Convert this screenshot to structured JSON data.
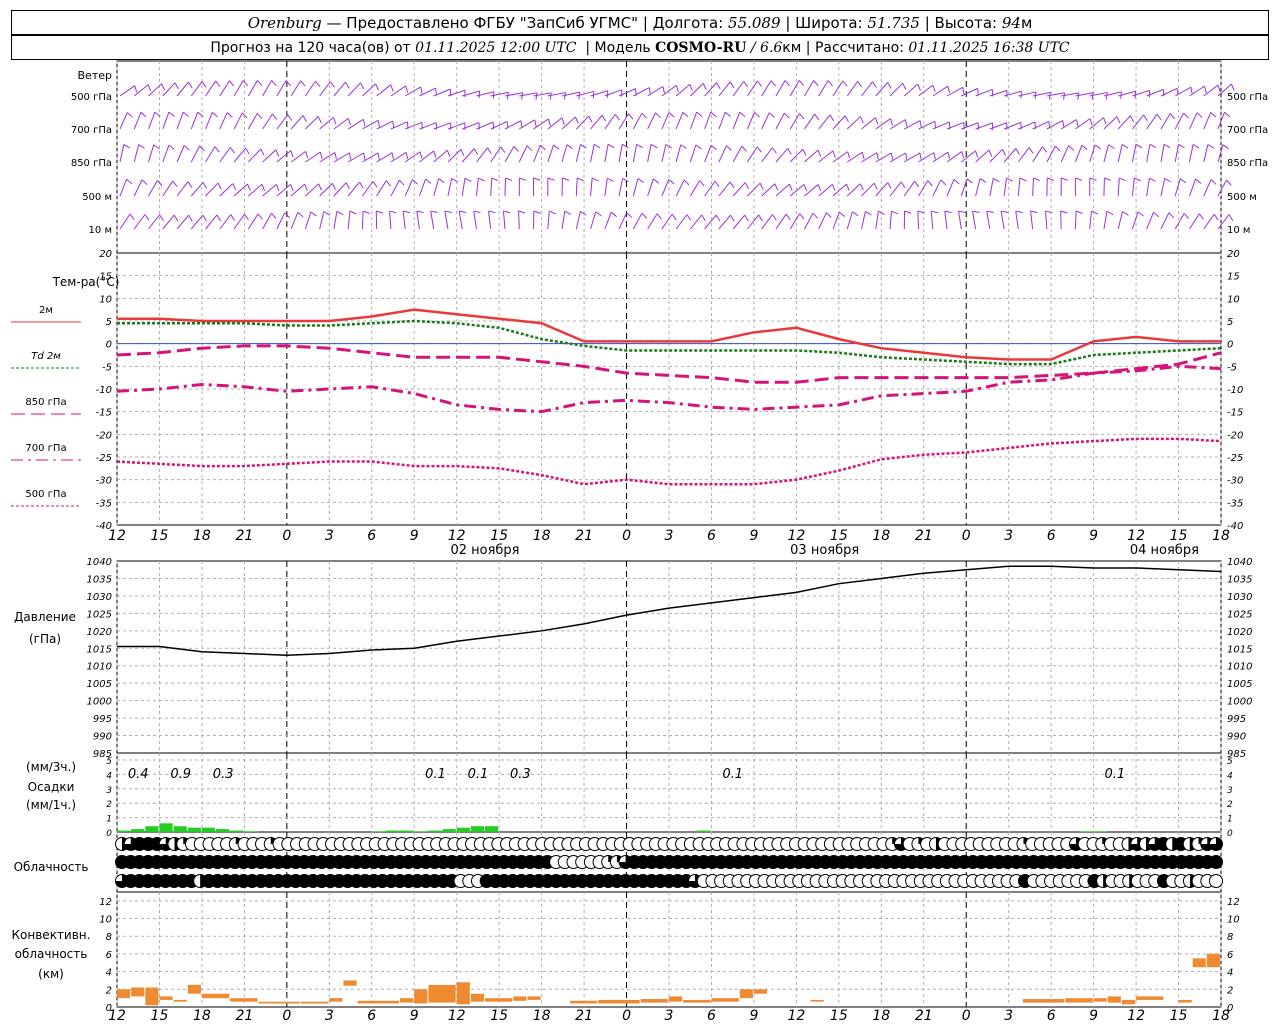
{
  "header": {
    "city": "Orenburg",
    "dash": "—",
    "provider": "Предоставлено ФГБУ \"ЗапСиб УГМС\"",
    "lon_label": "Долгота:",
    "lon": "55.089",
    "lat_label": "Широта:",
    "lat": "51.735",
    "alt_label": "Высота:",
    "alt": "94",
    "alt_unit": "м",
    "sep": "|"
  },
  "subheader": {
    "forecast_label": "Прогноз на 120 часа(ов) от",
    "forecast_time": "01.11.2025 12:00 UTC",
    "model_label": "Модель",
    "model": "COSMO-RU",
    "model_res_sep": "/",
    "model_res": "6.6",
    "model_res_unit": "км",
    "calc_label": "Рассчитано:",
    "calc_time": "01.11.2025 16:38 UTC",
    "sep": "|"
  },
  "colors": {
    "wind": "#9b30d9",
    "t2m": "#e83a3a",
    "td2m": "#1a7a1a",
    "t850": "#d4147a",
    "t700": "#d4147a",
    "t500": "#d4147a",
    "zero_line": "#3050d0",
    "pressure": "#000000",
    "precip": "#22cc22",
    "convective": "#f08a30",
    "grid": "#b0b0b0"
  },
  "labels": {
    "wind_title": "Ветер",
    "wind_levels": [
      "500 гПа",
      "700 гПа",
      "850 гПа",
      "500 м",
      "10  м"
    ],
    "temp_title": "Тем-ра(°С)",
    "temp_legend": [
      "2м",
      "Td  2м",
      "850 гПа",
      "700 гПа",
      "500 гПа"
    ],
    "pressure_title": "Давление",
    "pressure_unit": "(гПа)",
    "precip_labels": [
      "(мм/3ч.)",
      "Осадки",
      "(мм/1ч.)"
    ],
    "cloud_title": "Облачность",
    "conv_labels": [
      "Конвективн.",
      "облачность",
      "(км)"
    ]
  },
  "time_axis": {
    "ticks": [
      "12",
      "15",
      "18",
      "21",
      "0",
      "3",
      "6",
      "9",
      "12",
      "15",
      "18",
      "21",
      "0",
      "3",
      "6",
      "9",
      "12",
      "15",
      "18",
      "21",
      "0",
      "3",
      "6",
      "9",
      "12",
      "15",
      "18"
    ],
    "dates": [
      "02 ноября",
      "03 ноября",
      "04 ноября"
    ]
  },
  "chart_data": [
    {
      "type": "line",
      "title": "Тем-ра(°С)",
      "ylim": [
        -40,
        20
      ],
      "yticks": [
        20,
        15,
        10,
        5,
        0,
        -5,
        -10,
        -15,
        -20,
        -25,
        -30,
        -35,
        -40
      ],
      "x_hours": [
        0,
        3,
        6,
        9,
        12,
        15,
        18,
        21,
        24,
        27,
        30,
        33,
        36,
        39,
        42,
        45,
        48,
        51,
        54,
        57,
        60,
        63,
        66,
        69,
        72,
        75,
        78
      ],
      "series": [
        {
          "name": "2м",
          "values": [
            5.5,
            5.5,
            5.0,
            5.0,
            5.0,
            5.0,
            6.0,
            7.5,
            6.5,
            5.5,
            4.5,
            0.5,
            0.5,
            0.5,
            0.5,
            2.5,
            3.5,
            1.0,
            -1.0,
            -2.0,
            -3.0,
            -3.5,
            -3.5,
            0.5,
            1.5,
            0.5,
            0.5
          ]
        },
        {
          "name": "Td  2м",
          "values": [
            4.5,
            4.5,
            4.5,
            4.5,
            4.0,
            4.0,
            4.5,
            5.0,
            4.5,
            3.5,
            1.0,
            -0.5,
            -1.5,
            -1.5,
            -1.5,
            -1.5,
            -1.5,
            -2.0,
            -3.0,
            -3.5,
            -4.0,
            -4.5,
            -4.5,
            -2.5,
            -2.0,
            -1.5,
            -1.0
          ]
        },
        {
          "name": "850 гПа",
          "values": [
            -2.5,
            -2.0,
            -1.0,
            -0.5,
            -0.5,
            -1.0,
            -2.0,
            -3.0,
            -3.0,
            -3.0,
            -4.0,
            -5.0,
            -6.5,
            -7.0,
            -7.5,
            -8.5,
            -8.5,
            -7.5,
            -7.5,
            -7.5,
            -7.5,
            -7.5,
            -7.0,
            -6.5,
            -5.5,
            -4.5,
            -2.0
          ]
        },
        {
          "name": "700 гПа",
          "values": [
            -10.5,
            -10.0,
            -9.0,
            -9.5,
            -10.5,
            -10.0,
            -9.5,
            -11.0,
            -13.5,
            -14.5,
            -15.0,
            -13.0,
            -12.5,
            -13.0,
            -14.0,
            -14.5,
            -14.0,
            -13.5,
            -11.5,
            -11.0,
            -10.5,
            -8.5,
            -8.0,
            -6.5,
            -6.0,
            -5.0,
            -5.5
          ]
        },
        {
          "name": "500 гПа",
          "values": [
            -26.0,
            -26.5,
            -27.0,
            -27.0,
            -26.5,
            -26.0,
            -26.0,
            -27.0,
            -27.0,
            -27.5,
            -29.0,
            -31.0,
            -30.0,
            -31.0,
            -31.0,
            -31.0,
            -30.0,
            -28.0,
            -25.5,
            -24.5,
            -24.0,
            -23.0,
            -22.0,
            -21.5,
            -21.0,
            -21.0,
            -21.5
          ]
        }
      ]
    },
    {
      "type": "line",
      "title": "Давление",
      "ylabel": "(гПа)",
      "ylim": [
        985,
        1040
      ],
      "yticks": [
        1040,
        1035,
        1030,
        1025,
        1020,
        1015,
        1010,
        1005,
        1000,
        995,
        990,
        985
      ],
      "x_hours": [
        0,
        3,
        6,
        9,
        12,
        15,
        18,
        21,
        24,
        27,
        30,
        33,
        36,
        39,
        42,
        45,
        48,
        51,
        54,
        57,
        60,
        63,
        66,
        69,
        72,
        75,
        78
      ],
      "series": [
        {
          "name": "Давление",
          "values": [
            1015.5,
            1015.5,
            1014.0,
            1013.5,
            1013.0,
            1013.5,
            1014.5,
            1015.0,
            1017.0,
            1018.5,
            1020.0,
            1022.0,
            1024.5,
            1026.5,
            1028.0,
            1029.5,
            1031.0,
            1033.5,
            1035.0,
            1036.5,
            1037.5,
            1038.5,
            1038.5,
            1038.0,
            1038.0,
            1037.5,
            1037.0
          ]
        }
      ]
    },
    {
      "type": "bar",
      "title": "Осадки",
      "ylim": [
        0,
        5
      ],
      "yticks": [
        5,
        4,
        3,
        2,
        1,
        0
      ],
      "x_hours": [
        1,
        2,
        3,
        4,
        5,
        6,
        7,
        8,
        9,
        10,
        19,
        20,
        21,
        22,
        23,
        24,
        25,
        26,
        27,
        42,
        69,
        70
      ],
      "values": [
        0.1,
        0.2,
        0.4,
        0.6,
        0.4,
        0.3,
        0.3,
        0.2,
        0.1,
        0.05,
        0.05,
        0.1,
        0.1,
        0.05,
        0.1,
        0.2,
        0.3,
        0.4,
        0.4,
        0.1,
        0.05,
        0.05
      ],
      "sum_labels": [
        {
          "hour": 1.5,
          "text": "0.4"
        },
        {
          "hour": 4.5,
          "text": "0.9"
        },
        {
          "hour": 7.5,
          "text": "0.3"
        },
        {
          "hour": 22.5,
          "text": "0.1"
        },
        {
          "hour": 25.5,
          "text": "0.1"
        },
        {
          "hour": 28.5,
          "text": "0.3"
        },
        {
          "hour": 43.5,
          "text": "0.1"
        },
        {
          "hour": 70.5,
          "text": "0.1"
        }
      ]
    },
    {
      "type": "bar",
      "title": "Конвективн. облачность",
      "ylabel": "(км)",
      "ylim": [
        0,
        13
      ],
      "yticks": [
        12,
        10,
        8,
        6,
        4,
        2,
        0
      ],
      "bars": [
        [
          0,
          1,
          1.0,
          2.0
        ],
        [
          1,
          2,
          1.2,
          2.2
        ],
        [
          2,
          3,
          0.2,
          2.2
        ],
        [
          3,
          4,
          0.8,
          1.2
        ],
        [
          4,
          5,
          0.6,
          0.8
        ],
        [
          5,
          6,
          1.5,
          2.5
        ],
        [
          6,
          8,
          1.0,
          1.5
        ],
        [
          8,
          10,
          0.6,
          1.0
        ],
        [
          10,
          13,
          0.4,
          0.6
        ],
        [
          13,
          15,
          0.4,
          0.6
        ],
        [
          15,
          16,
          0.6,
          1.0
        ],
        [
          16,
          17,
          2.4,
          3.0
        ],
        [
          17,
          20,
          0.4,
          0.7
        ],
        [
          20,
          21,
          0.5,
          1.0
        ],
        [
          21,
          22,
          0.4,
          2.0
        ],
        [
          22,
          24,
          0.5,
          2.5
        ],
        [
          24,
          25,
          0.3,
          2.8
        ],
        [
          25,
          26,
          0.6,
          1.5
        ],
        [
          26,
          28,
          0.6,
          1.0
        ],
        [
          28,
          29,
          0.7,
          1.2
        ],
        [
          29,
          30,
          0.8,
          1.2
        ],
        [
          32,
          34,
          0.4,
          0.7
        ],
        [
          34,
          37,
          0.4,
          0.8
        ],
        [
          37,
          39,
          0.5,
          0.9
        ],
        [
          39,
          40,
          0.6,
          1.2
        ],
        [
          40,
          42,
          0.5,
          0.8
        ],
        [
          42,
          44,
          0.6,
          1.0
        ],
        [
          44,
          45,
          1.0,
          2.0
        ],
        [
          45,
          46,
          1.5,
          2.0
        ],
        [
          49,
          50,
          0.6,
          0.8
        ],
        [
          64,
          67,
          0.5,
          0.9
        ],
        [
          67,
          69,
          0.5,
          1.0
        ],
        [
          69,
          70,
          0.6,
          1.0
        ],
        [
          70,
          71,
          0.5,
          1.2
        ],
        [
          71,
          72,
          0.3,
          0.8
        ],
        [
          72,
          74,
          0.8,
          1.2
        ],
        [
          75,
          76,
          0.5,
          0.8
        ],
        [
          76,
          77,
          4.5,
          5.5
        ],
        [
          77,
          78,
          4.5,
          6.0
        ]
      ]
    }
  ],
  "cloud_cover": {
    "rows": [
      [
        4,
        6,
        8,
        8,
        8,
        6,
        4,
        2,
        0,
        0,
        0,
        0,
        0,
        2,
        0,
        0,
        0,
        2,
        0,
        0,
        0,
        0,
        0,
        0,
        0,
        0,
        0,
        0,
        0,
        0,
        0,
        0,
        0,
        0,
        0,
        0,
        0,
        0,
        0,
        0,
        0,
        0,
        0,
        0,
        0,
        0,
        0,
        0,
        0,
        0,
        0,
        0,
        0,
        0,
        0,
        0,
        0,
        0,
        0,
        0,
        0,
        0,
        0,
        0,
        0,
        0,
        0,
        0,
        0,
        0,
        0,
        0,
        0,
        0,
        0,
        0,
        0,
        0,
        0,
        0,
        0,
        0,
        0,
        0,
        0,
        0,
        0,
        0,
        2,
        6,
        0,
        2,
        0,
        4,
        0,
        0,
        0,
        0,
        0,
        0,
        0,
        0,
        0,
        2,
        0,
        0,
        0,
        0,
        0,
        6,
        0,
        0,
        2,
        0,
        0,
        4,
        6,
        4,
        6,
        8,
        4,
        8,
        4,
        2,
        6,
        6
      ],
      [
        8,
        8,
        8,
        8,
        8,
        8,
        8,
        8,
        8,
        8,
        8,
        8,
        8,
        8,
        8,
        8,
        8,
        8,
        8,
        8,
        8,
        8,
        8,
        8,
        8,
        8,
        8,
        8,
        8,
        8,
        8,
        8,
        8,
        8,
        8,
        8,
        8,
        8,
        8,
        8,
        8,
        8,
        8,
        8,
        8,
        8,
        8,
        8,
        8,
        8,
        0,
        0,
        0,
        0,
        0,
        0,
        2,
        2,
        6,
        8,
        8,
        8,
        8,
        8,
        8,
        8,
        8,
        8,
        8,
        8,
        8,
        8,
        8,
        8,
        8,
        8,
        8,
        8,
        8,
        8,
        8,
        8,
        8,
        8,
        8,
        8,
        8,
        8,
        8,
        8,
        8,
        8,
        8,
        8,
        8,
        8,
        8,
        8,
        8,
        8,
        8,
        8,
        8,
        8,
        8,
        8,
        8,
        8,
        8,
        8,
        8,
        8,
        8,
        8,
        8,
        8,
        8,
        8,
        8,
        8,
        8,
        8,
        8,
        8,
        8,
        8,
        8
      ],
      [
        6,
        8,
        8,
        8,
        8,
        8,
        8,
        8,
        8,
        4,
        8,
        8,
        8,
        8,
        8,
        8,
        8,
        8,
        8,
        8,
        8,
        8,
        8,
        8,
        8,
        8,
        8,
        8,
        8,
        8,
        8,
        8,
        8,
        8,
        8,
        8,
        8,
        8,
        8,
        0,
        0,
        0,
        8,
        8,
        8,
        8,
        8,
        8,
        8,
        8,
        8,
        8,
        8,
        8,
        8,
        8,
        8,
        8,
        8,
        8,
        8,
        8,
        8,
        8,
        8,
        8,
        6,
        0,
        0,
        0,
        0,
        0,
        0,
        0,
        0,
        0,
        0,
        0,
        0,
        0,
        0,
        0,
        0,
        0,
        0,
        0,
        0,
        0,
        0,
        0,
        0,
        0,
        0,
        0,
        0,
        0,
        0,
        0,
        0,
        0,
        0,
        0,
        0,
        0,
        8,
        0,
        0,
        0,
        0,
        0,
        0,
        0,
        8,
        4,
        0,
        0,
        4,
        0,
        0,
        0,
        8,
        0,
        0,
        4,
        0,
        0,
        0
      ]
    ]
  }
}
